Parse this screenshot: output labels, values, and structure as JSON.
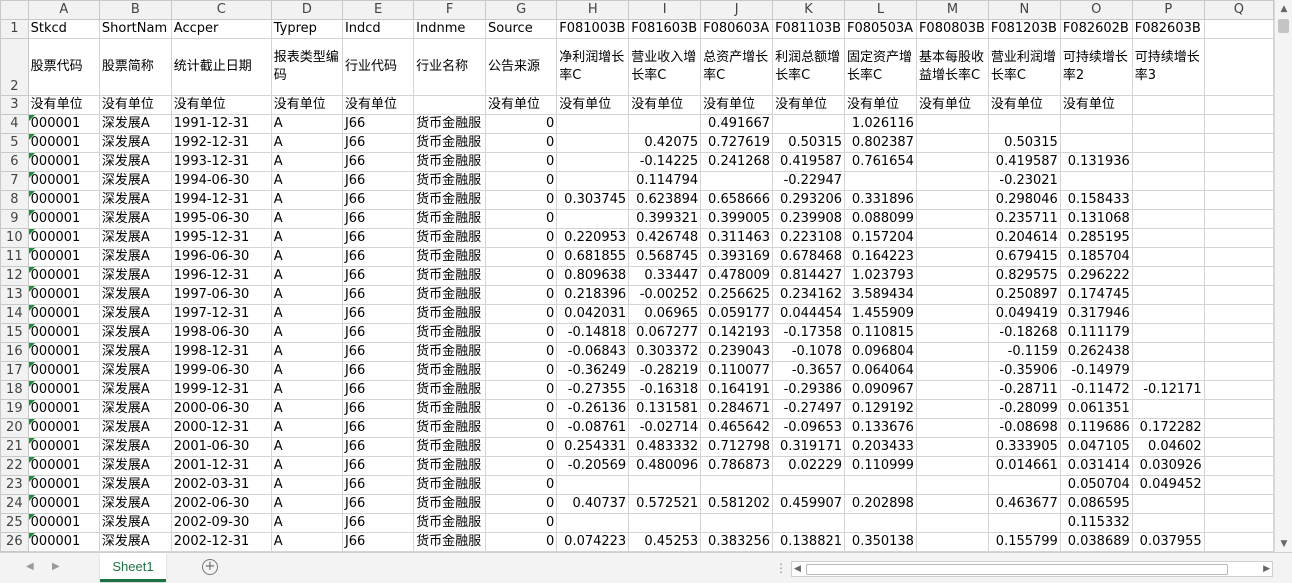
{
  "columns": [
    "A",
    "B",
    "C",
    "D",
    "E",
    "F",
    "G",
    "H",
    "I",
    "J",
    "K",
    "L",
    "M",
    "N",
    "O",
    "P",
    "Q"
  ],
  "header_rows": [
    [
      "Stkcd",
      "ShortNam",
      "Accper",
      "Typrep",
      "Indcd",
      "Indnme",
      "Source",
      "F081003B",
      "F081603B",
      "F080603A",
      "F081103B",
      "F080503A",
      "F080803B",
      "F081203B",
      "F082602B",
      "F082603B",
      ""
    ],
    [
      "股票代码",
      "股票简称",
      "统计截止日期",
      "报表类型编码",
      "行业代码",
      "行业名称",
      "公告来源",
      "净利润增长率C",
      "营业收入增长率C",
      "总资产增长率C",
      "利润总额增长率C",
      "固定资产增长率C",
      "基本每股收益增长率C",
      "营业利润增长率C",
      "可持续增长率2",
      "可持续增长率3",
      ""
    ],
    [
      "没有单位",
      "没有单位",
      "没有单位",
      "没有单位",
      "没有单位",
      "",
      "没有单位",
      "没有单位",
      "没有单位",
      "没有单位",
      "没有单位",
      "没有单位",
      "没有单位",
      "没有单位",
      "没有单位",
      "",
      ""
    ]
  ],
  "data_rows": [
    [
      "000001",
      "深发展A",
      "1991-12-31",
      "A",
      "J66",
      "货币金融服",
      "0",
      "",
      "",
      "0.491667",
      "",
      "1.026116",
      "",
      "",
      "",
      "",
      ""
    ],
    [
      "000001",
      "深发展A",
      "1992-12-31",
      "A",
      "J66",
      "货币金融服",
      "0",
      "",
      "0.42075",
      "0.727619",
      "0.50315",
      "0.802387",
      "",
      "0.50315",
      "",
      "",
      ""
    ],
    [
      "000001",
      "深发展A",
      "1993-12-31",
      "A",
      "J66",
      "货币金融服",
      "0",
      "",
      "-0.14225",
      "0.241268",
      "0.419587",
      "0.761654",
      "",
      "0.419587",
      "0.131936",
      "",
      ""
    ],
    [
      "000001",
      "深发展A",
      "1994-06-30",
      "A",
      "J66",
      "货币金融服",
      "0",
      "",
      "0.114794",
      "",
      "-0.22947",
      "",
      "",
      "-0.23021",
      "",
      "",
      ""
    ],
    [
      "000001",
      "深发展A",
      "1994-12-31",
      "A",
      "J66",
      "货币金融服",
      "0",
      "0.303745",
      "0.623894",
      "0.658666",
      "0.293206",
      "0.331896",
      "",
      "0.298046",
      "0.158433",
      "",
      ""
    ],
    [
      "000001",
      "深发展A",
      "1995-06-30",
      "A",
      "J66",
      "货币金融服",
      "0",
      "",
      "0.399321",
      "0.399005",
      "0.239908",
      "0.088099",
      "",
      "0.235711",
      "0.131068",
      "",
      ""
    ],
    [
      "000001",
      "深发展A",
      "1995-12-31",
      "A",
      "J66",
      "货币金融服",
      "0",
      "0.220953",
      "0.426748",
      "0.311463",
      "0.223108",
      "0.157204",
      "",
      "0.204614",
      "0.285195",
      "",
      ""
    ],
    [
      "000001",
      "深发展A",
      "1996-06-30",
      "A",
      "J66",
      "货币金融服",
      "0",
      "0.681855",
      "0.568745",
      "0.393169",
      "0.678468",
      "0.164223",
      "",
      "0.679415",
      "0.185704",
      "",
      ""
    ],
    [
      "000001",
      "深发展A",
      "1996-12-31",
      "A",
      "J66",
      "货币金融服",
      "0",
      "0.809638",
      "0.33447",
      "0.478009",
      "0.814427",
      "1.023793",
      "",
      "0.829575",
      "0.296222",
      "",
      ""
    ],
    [
      "000001",
      "深发展A",
      "1997-06-30",
      "A",
      "J66",
      "货币金融服",
      "0",
      "0.218396",
      "-0.00252",
      "0.256625",
      "0.234162",
      "3.589434",
      "",
      "0.250897",
      "0.174745",
      "",
      ""
    ],
    [
      "000001",
      "深发展A",
      "1997-12-31",
      "A",
      "J66",
      "货币金融服",
      "0",
      "0.042031",
      "0.06965",
      "0.059177",
      "0.044454",
      "1.455909",
      "",
      "0.049419",
      "0.317946",
      "",
      ""
    ],
    [
      "000001",
      "深发展A",
      "1998-06-30",
      "A",
      "J66",
      "货币金融服",
      "0",
      "-0.14818",
      "0.067277",
      "0.142193",
      "-0.17358",
      "0.110815",
      "",
      "-0.18268",
      "0.111179",
      "",
      ""
    ],
    [
      "000001",
      "深发展A",
      "1998-12-31",
      "A",
      "J66",
      "货币金融服",
      "0",
      "-0.06843",
      "0.303372",
      "0.239043",
      "-0.1078",
      "0.096804",
      "",
      "-0.1159",
      "0.262438",
      "",
      ""
    ],
    [
      "000001",
      "深发展A",
      "1999-06-30",
      "A",
      "J66",
      "货币金融服",
      "0",
      "-0.36249",
      "-0.28219",
      "0.110077",
      "-0.3657",
      "0.064064",
      "",
      "-0.35906",
      "-0.14979",
      "",
      ""
    ],
    [
      "000001",
      "深发展A",
      "1999-12-31",
      "A",
      "J66",
      "货币金融服",
      "0",
      "-0.27355",
      "-0.16318",
      "0.164191",
      "-0.29386",
      "0.090967",
      "",
      "-0.28711",
      "-0.11472",
      "-0.12171",
      ""
    ],
    [
      "000001",
      "深发展A",
      "2000-06-30",
      "A",
      "J66",
      "货币金融服",
      "0",
      "-0.26136",
      "0.131581",
      "0.284671",
      "-0.27497",
      "0.129192",
      "",
      "-0.28099",
      "0.061351",
      "",
      ""
    ],
    [
      "000001",
      "深发展A",
      "2000-12-31",
      "A",
      "J66",
      "货币金融服",
      "0",
      "-0.08761",
      "-0.02714",
      "0.465642",
      "-0.09653",
      "0.133676",
      "",
      "-0.08698",
      "0.119686",
      "0.172282",
      ""
    ],
    [
      "000001",
      "深发展A",
      "2001-06-30",
      "A",
      "J66",
      "货币金融服",
      "0",
      "0.254331",
      "0.483332",
      "0.712798",
      "0.319171",
      "0.203433",
      "",
      "0.333905",
      "0.047105",
      "0.04602",
      ""
    ],
    [
      "000001",
      "深发展A",
      "2001-12-31",
      "A",
      "J66",
      "货币金融服",
      "0",
      "-0.20569",
      "0.480096",
      "0.786873",
      "0.02229",
      "0.110999",
      "",
      "0.014661",
      "0.031414",
      "0.030926",
      ""
    ],
    [
      "000001",
      "深发展A",
      "2002-03-31",
      "A",
      "J66",
      "货币金融服",
      "0",
      "",
      "",
      "",
      "",
      "",
      "",
      "",
      "0.050704",
      "0.049452",
      ""
    ],
    [
      "000001",
      "深发展A",
      "2002-06-30",
      "A",
      "J66",
      "货币金融服",
      "0",
      "0.40737",
      "0.572521",
      "0.581202",
      "0.459907",
      "0.202898",
      "",
      "0.463677",
      "0.086595",
      "",
      ""
    ],
    [
      "000001",
      "深发展A",
      "2002-09-30",
      "A",
      "J66",
      "货币金融服",
      "0",
      "",
      "",
      "",
      "",
      "",
      "",
      "",
      "0.115332",
      "",
      ""
    ],
    [
      "000001",
      "深发展A",
      "2002-12-31",
      "A",
      "J66",
      "货币金融服",
      "0",
      "0.074223",
      "0.45253",
      "0.383256",
      "0.138821",
      "0.350138",
      "",
      "0.155799",
      "0.038689",
      "0.037955",
      ""
    ]
  ],
  "first_data_row_number": 4,
  "sheet_tab": "Sheet1",
  "add_sheet_symbol": "+",
  "colors": {
    "tab_accent": "#1e7145",
    "text_indicator": "#1e8e3e"
  }
}
